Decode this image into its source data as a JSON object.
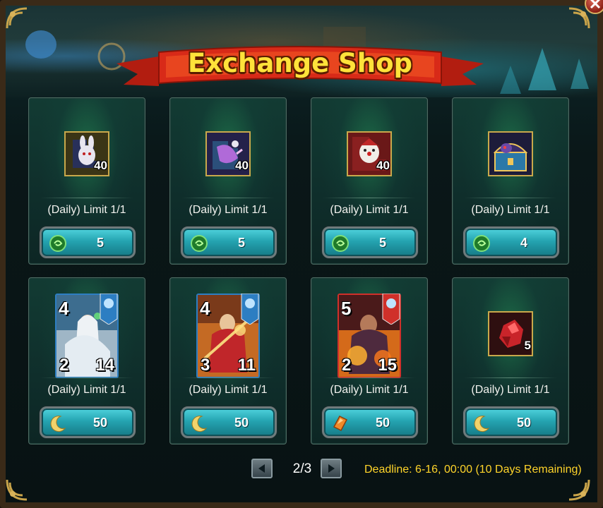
{
  "window": {
    "title": "Exchange Shop"
  },
  "items": [
    {
      "limit": "(Daily) Limit 1/1",
      "icon": "white-rabbit-puzzle-icon",
      "qty": "40",
      "type": "item",
      "price": "5",
      "currency": "green-orb-icon",
      "bg": "#2c2a10"
    },
    {
      "limit": "(Daily) Limit 1/1",
      "icon": "purple-beast-puzzle-icon",
      "qty": "40",
      "type": "item",
      "price": "5",
      "currency": "green-orb-icon",
      "bg": "#27213d"
    },
    {
      "limit": "(Daily) Limit 1/1",
      "icon": "red-clown-puzzle-icon",
      "qty": "40",
      "type": "item",
      "price": "5",
      "currency": "green-orb-icon",
      "bg": "#5a1616"
    },
    {
      "limit": "(Daily) Limit 1/1",
      "icon": "treasure-chest-icon",
      "qty": "",
      "type": "item",
      "price": "4",
      "currency": "green-orb-icon",
      "bg": "#242344"
    },
    {
      "limit": "(Daily) Limit 1/1",
      "icon": "white-priestess-hero-card",
      "star": "4",
      "atk": "2",
      "hp": "14",
      "type": "hero",
      "price": "50",
      "currency": "crescent-moon-icon",
      "frame": "#2d7ec2"
    },
    {
      "limit": "(Daily) Limit 1/1",
      "icon": "golden-warrior-hero-card",
      "star": "4",
      "atk": "3",
      "hp": "11",
      "type": "hero",
      "price": "50",
      "currency": "crescent-moon-icon",
      "frame": "#2d7ec2"
    },
    {
      "limit": "(Daily) Limit 1/1",
      "icon": "flame-warrior-hero-card",
      "star": "5",
      "atk": "2",
      "hp": "15",
      "type": "hero",
      "price": "50",
      "currency": "orange-crystal-icon",
      "frame": "#d0302a"
    },
    {
      "limit": "(Daily) Limit 1/1",
      "icon": "red-crystal-icon",
      "qty": "5",
      "type": "item",
      "price": "50",
      "currency": "crescent-moon-icon",
      "bg": "#3a1414"
    }
  ],
  "pager": {
    "label": "2/3"
  },
  "deadline": "Deadline: 6-16, 00:00 (10 Days Remaining)",
  "colors": {
    "accent": "#ffd42a",
    "button": "#25a4b1",
    "title": "#ffe23a"
  }
}
